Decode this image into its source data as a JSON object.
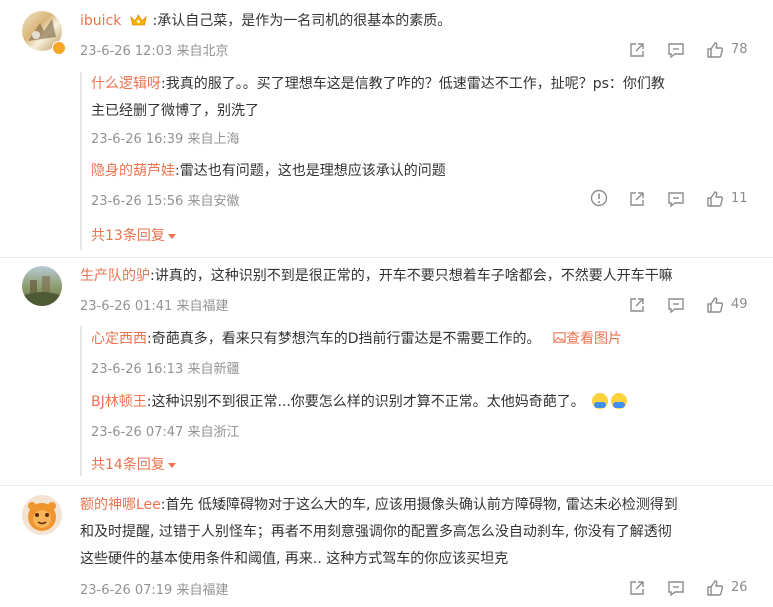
{
  "comments": [
    {
      "user": "ibuick",
      "text": ":承认自己菜，是作为一名司机的很基本的素质。",
      "time": "23-6-26 12:03",
      "location": "来自北京",
      "likes": "78",
      "replies": [
        {
          "user": "什么逻辑呀",
          "text": ":我真的服了。。买了理想车这是信教了咋的？低速雷达不工作，扯呢？ps：你们教",
          "text2": "主已经删了微博了，别洗了",
          "time": "23-6-26 16:39",
          "location": "来自上海"
        },
        {
          "user": "隐身的葫芦娃",
          "text": ":雷达也有问题，这也是理想应该承认的问题",
          "time": "23-6-26 15:56",
          "location": "来自安徽",
          "likes": "11"
        }
      ],
      "more": "共13条回复"
    },
    {
      "user": "生产队的驴",
      "text": ":讲真的，这种识别不到是很正常的，开车不要只想着车子啥都会，不然要人开车干嘛",
      "time": "23-6-26 01:41",
      "location": "来自福建",
      "likes": "49",
      "replies": [
        {
          "user": "心定西西",
          "text": ":奇葩真多，看来只有梦想汽车的D挡前行雷达是不需要工作的。",
          "pic": "查看图片",
          "time": "23-6-26 16:13",
          "location": "来自新疆"
        },
        {
          "user": "BJ林顿王",
          "text": ":这种识别不到很正常...你要怎么样的识别才算不正常。太他妈奇葩了。",
          "time": "23-6-26 07:47",
          "location": "来自浙江"
        }
      ],
      "more": "共14条回复"
    },
    {
      "user": "额的神哪Lee",
      "text": ":首先 低矮障碍物对于这么大的车, 应该用摄像头确认前方障碍物, 雷达未必检测得到",
      "text2": "和及时提醒, 过错于人别怪车；再者不用刻意强调你的配置多高怎么没自动刹车, 你没有了解透彻",
      "text3": "这些硬件的基本使用条件和阈值, 再来.. 这种方式驾车的你应该买坦克",
      "time": "23-6-26 07:19",
      "location": "来自福建",
      "likes": "26"
    }
  ],
  "colors": {
    "accent": "#eb7350",
    "meta": "#939393",
    "text": "#333333",
    "icon": "#8c8c8c"
  },
  "icons": [
    "share-icon",
    "comment-icon",
    "like-icon",
    "report-icon",
    "image-icon",
    "vip-crown-icon"
  ]
}
